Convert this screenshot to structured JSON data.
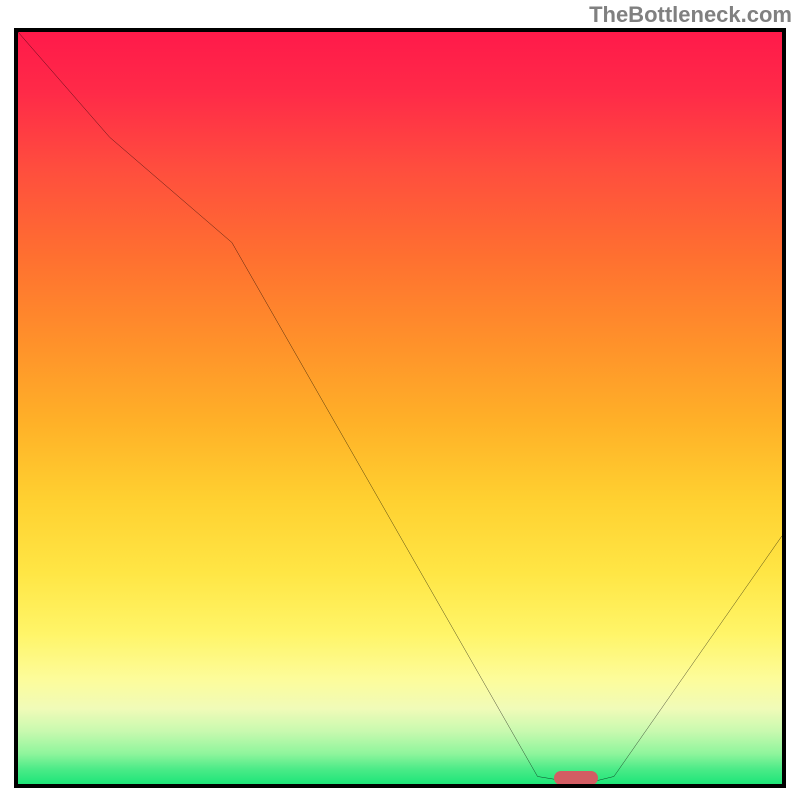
{
  "watermark": "TheBottleneck.com",
  "chart_data": {
    "type": "line",
    "title": "",
    "xlabel": "",
    "ylabel": "",
    "xlim": [
      0,
      100
    ],
    "ylim": [
      0,
      100
    ],
    "series": [
      {
        "name": "curve",
        "x": [
          0,
          12,
          28,
          68,
          74,
          78,
          100
        ],
        "values": [
          100,
          86,
          72,
          1,
          0,
          1,
          33
        ]
      }
    ],
    "marker": {
      "x": 73,
      "y": 0.8,
      "width_pct": 5.8
    },
    "gradient_stops": [
      {
        "pos": 0,
        "color": "#ff1a4a"
      },
      {
        "pos": 8,
        "color": "#ff2a48"
      },
      {
        "pos": 18,
        "color": "#ff4d3e"
      },
      {
        "pos": 30,
        "color": "#ff7030"
      },
      {
        "pos": 42,
        "color": "#ff932a"
      },
      {
        "pos": 52,
        "color": "#ffb128"
      },
      {
        "pos": 62,
        "color": "#ffd030"
      },
      {
        "pos": 72,
        "color": "#ffe645"
      },
      {
        "pos": 80,
        "color": "#fff568"
      },
      {
        "pos": 86,
        "color": "#fdfc9a"
      },
      {
        "pos": 90,
        "color": "#f0fbb8"
      },
      {
        "pos": 93,
        "color": "#c8f9af"
      },
      {
        "pos": 96,
        "color": "#8ef59c"
      },
      {
        "pos": 98,
        "color": "#4ceb88"
      },
      {
        "pos": 100,
        "color": "#1de578"
      }
    ],
    "colors": {
      "frame": "#000000",
      "curve": "#000000",
      "marker": "#d35d63"
    }
  }
}
